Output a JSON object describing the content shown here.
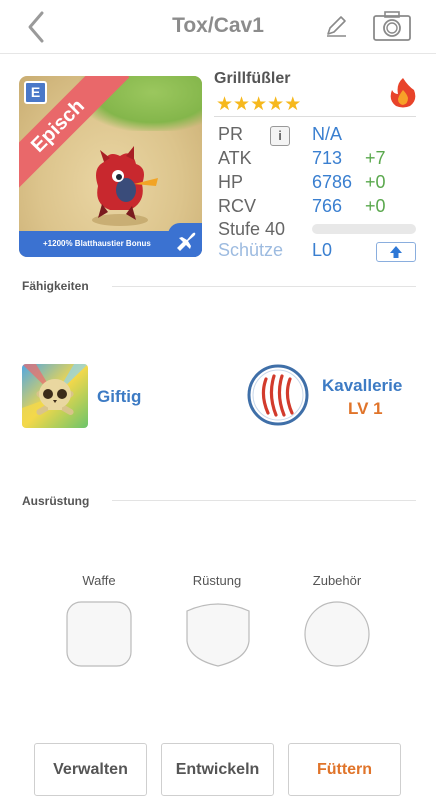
{
  "nav": {
    "title": "Tox/Cav1",
    "back_icon": "chevron-left-icon",
    "edit_icon": "pencil-icon",
    "camera_icon": "camera-icon"
  },
  "card": {
    "rarity_badge": "E",
    "rarity_ribbon": "Episch",
    "bonus_text": "+1200% Blatthaustier Bonus",
    "corner_icon": "airplane-icon"
  },
  "pet": {
    "name": "Grillfüßler",
    "stars": 5,
    "element_icon": "fire-icon"
  },
  "stats": {
    "pr": {
      "label": "PR",
      "value": "N/A"
    },
    "atk": {
      "label": "ATK",
      "value": "713",
      "bonus": "+7"
    },
    "hp": {
      "label": "HP",
      "value": "6786",
      "bonus": "+0"
    },
    "rcv": {
      "label": "RCV",
      "value": "766",
      "bonus": "+0"
    },
    "level_label": "Stufe 40",
    "level_progress": 0,
    "class_label": "Schütze",
    "class_value": "L0"
  },
  "sections": {
    "abilities": "Fähigkeiten",
    "equipment": "Ausrüstung"
  },
  "skills": {
    "left": {
      "name": "Giftig",
      "icon": "poison-skull-icon"
    },
    "right": {
      "name": "Kavallerie",
      "level": "LV 1",
      "icon": "claw-marks-icon"
    }
  },
  "equipment": {
    "weapon": "Waffe",
    "armor": "Rüstung",
    "accessory": "Zubehör"
  },
  "actions": {
    "manage": "Verwalten",
    "evolve": "Entwickeln",
    "feed": "Füttern"
  },
  "colors": {
    "accent_blue": "#3a7fd0",
    "bonus_green": "#5aa84d",
    "feed_orange": "#e0742a",
    "star_gold": "#f6b81d",
    "ribbon_red": "#e9686a"
  }
}
